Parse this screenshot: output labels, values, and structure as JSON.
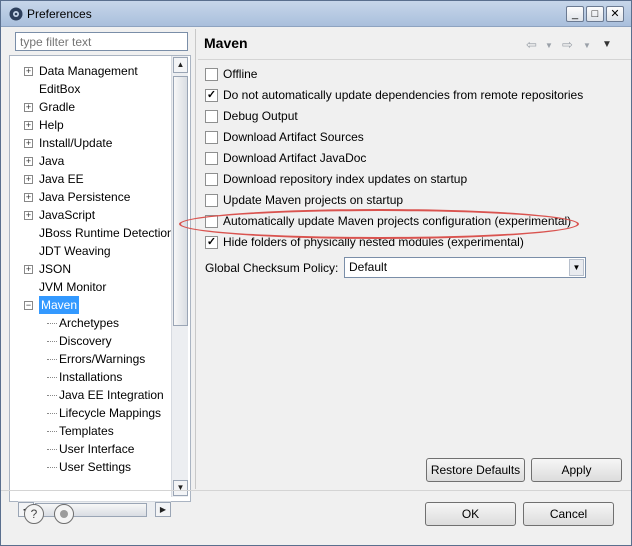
{
  "window": {
    "title": "Preferences",
    "controls": [
      "_",
      "□",
      "✕"
    ]
  },
  "filter": {
    "placeholder": "type filter text"
  },
  "tree": {
    "items": [
      {
        "label": "Data Management",
        "expandable": true
      },
      {
        "label": "EditBox",
        "expandable": false
      },
      {
        "label": "Gradle",
        "expandable": true
      },
      {
        "label": "Help",
        "expandable": true
      },
      {
        "label": "Install/Update",
        "expandable": true
      },
      {
        "label": "Java",
        "expandable": true
      },
      {
        "label": "Java EE",
        "expandable": true
      },
      {
        "label": "Java Persistence",
        "expandable": true
      },
      {
        "label": "JavaScript",
        "expandable": true
      },
      {
        "label": "JBoss Runtime Detection",
        "expandable": false
      },
      {
        "label": "JDT Weaving",
        "expandable": false
      },
      {
        "label": "JSON",
        "expandable": true
      },
      {
        "label": "JVM Monitor",
        "expandable": false
      },
      {
        "label": "Maven",
        "expandable": true,
        "expanded": true,
        "selected": true
      }
    ],
    "children": [
      "Archetypes",
      "Discovery",
      "Errors/Warnings",
      "Installations",
      "Java EE Integration",
      "Lifecycle Mappings",
      "Templates",
      "User Interface",
      "User Settings"
    ]
  },
  "page": {
    "title": "Maven",
    "options": [
      {
        "label": "Offline",
        "checked": false
      },
      {
        "label": "Do not automatically update dependencies from remote repositories",
        "checked": true
      },
      {
        "label": "Debug Output",
        "checked": false
      },
      {
        "label": "Download Artifact Sources",
        "checked": false
      },
      {
        "label": "Download Artifact JavaDoc",
        "checked": false
      },
      {
        "label": "Download repository index updates on startup",
        "checked": false
      },
      {
        "label": "Update Maven projects on startup",
        "checked": false
      },
      {
        "label": "Automatically update Maven projects configuration (experimental)",
        "checked": false,
        "highlighted": true
      },
      {
        "label": "Hide folders of physically nested modules (experimental)",
        "checked": true
      }
    ],
    "checksum_label": "Global Checksum Policy:",
    "checksum_value": "Default",
    "restore_defaults": "Restore Defaults",
    "apply": "Apply"
  },
  "footer": {
    "ok": "OK",
    "cancel": "Cancel",
    "help_icon": "?"
  },
  "colors": {
    "selection": "#3399ff",
    "highlight_oval": "#d9534f"
  }
}
